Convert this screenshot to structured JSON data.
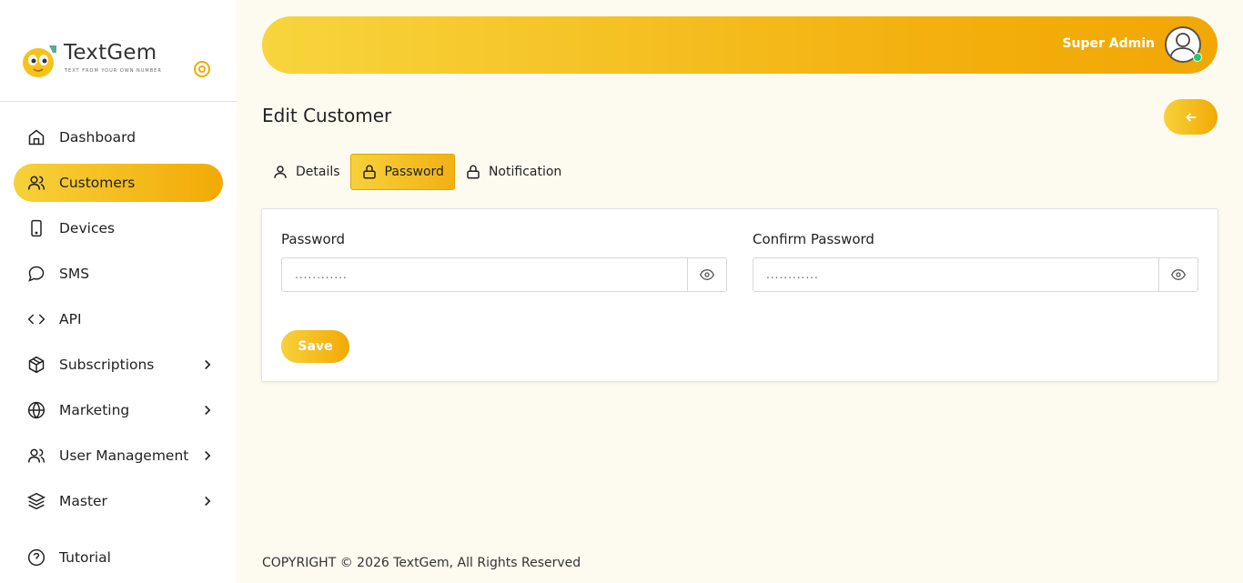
{
  "brand": {
    "name": "TextGem",
    "tagline": "TEXT FROM YOUR OWN NUMBER"
  },
  "sidebar": {
    "items": [
      {
        "label": "Dashboard",
        "icon": "home-icon"
      },
      {
        "label": "Customers",
        "icon": "users-icon",
        "active": true
      },
      {
        "label": "Devices",
        "icon": "smartphone-icon"
      },
      {
        "label": "SMS",
        "icon": "message-icon"
      },
      {
        "label": "API",
        "icon": "code-icon"
      },
      {
        "label": "Subscriptions",
        "icon": "package-icon",
        "expandable": true
      },
      {
        "label": "Marketing",
        "icon": "globe-icon",
        "expandable": true
      },
      {
        "label": "User Management",
        "icon": "users-icon",
        "expandable": true
      },
      {
        "label": "Master",
        "icon": "layers-icon",
        "expandable": true
      },
      {
        "label": "Tutorial",
        "icon": "help-icon"
      }
    ]
  },
  "header": {
    "user_name": "Super Admin"
  },
  "page": {
    "title": "Edit Customer"
  },
  "tabs": [
    {
      "label": "Details",
      "icon": "user-icon"
    },
    {
      "label": "Password",
      "icon": "lock-icon",
      "active": true
    },
    {
      "label": "Notification",
      "icon": "lock-icon"
    }
  ],
  "form": {
    "password_label": "Password",
    "password_value": "............",
    "confirm_label": "Confirm Password",
    "confirm_value": "............",
    "save_label": "Save"
  },
  "footer": {
    "copyright": "COPYRIGHT © 2026 TextGem, All Rights Reserved"
  },
  "colors": {
    "accent_start": "#f7d13a",
    "accent_end": "#f2aa05",
    "online": "#28c76f"
  }
}
